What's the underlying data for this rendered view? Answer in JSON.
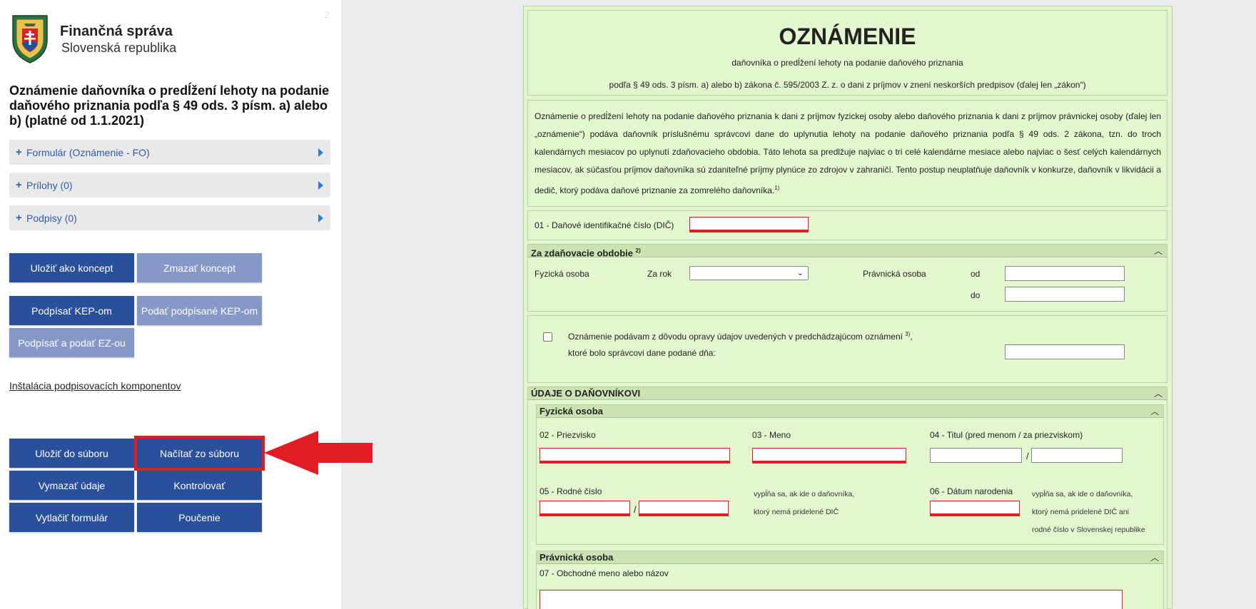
{
  "sidebar": {
    "page_number": "2",
    "brand_name": "Finančná správa",
    "brand_sub": "Slovenská republika",
    "doc_title": "Oznámenie daňovníka o predĺžení lehoty na podanie daňového priznania podľa § 49 ods. 3 písm. a) alebo b) (platné od 1.1.2021)",
    "accordion": [
      {
        "label": "Formulár (Oznámenie - FO)"
      },
      {
        "label": "Prílohy (0)"
      },
      {
        "label": "Podpisy (0)"
      }
    ],
    "buttons": {
      "save_draft": "Uložiť ako koncept",
      "delete_draft": "Zmazať koncept",
      "sign_kep": "Podpísať KEP-om",
      "submit_signed_kep": "Podať podpísané KEP-om",
      "sign_submit_ez": "Podpísať a podať EZ-ou",
      "save_file": "Uložiť do súboru",
      "load_file": "Načítať zo súboru",
      "clear_data": "Vymazať údaje",
      "validate": "Kontrolovať",
      "print": "Vytlačiť formulár",
      "instructions": "Poučenie"
    },
    "install_link": "Inštalácia podpisovacích komponentov"
  },
  "form": {
    "title": "OZNÁMENIE",
    "subtitle1": "daňovníka o predĺžení lehoty na podanie daňového priznania",
    "subtitle2": "podľa § 49 ods. 3 písm. a) alebo b) zákona č. 595/2003 Z. z. o dani z príjmov v znení neskorších predpisov (ďalej len „zákon“)",
    "intro": "Oznámenie o predĺžení lehoty na podanie daňového priznania k dani z príjmov fyzickej osoby alebo daňového priznania k dani z príjmov právnickej osoby (ďalej len „oznámenie“) podáva daňovník príslušnému správcovi dane do uplynutia lehoty na podanie daňového priznania podľa § 49 ods. 2 zákona, tzn. do troch kalendárnych mesiacov po uplynutí zdaňovacieho obdobia. Táto lehota sa predlžuje najviac o tri celé kalendárne mesiace alebo najviac o šesť celých kalendárnych mesiacov, ak súčasťou príjmov daňovníka sú zdaniteľné príjmy plynúce zo zdrojov v zahraničí. Tento postup neuplatňuje daňovník v konkurze, daňovník v likvidácii a dedič, ktorý podáva daňové priznanie za zomrelého daňovníka.",
    "intro_sup": "1)",
    "dic_label": "01 - Daňové identifikačné číslo (DIČ)",
    "period_header": "Za zdaňovacie obdobie",
    "period_sup": "2)",
    "fo_label": "Fyzická osoba",
    "year_label": "Za rok",
    "po_label": "Právnická osoba",
    "from_label": "od",
    "to_label": "do",
    "correction_text1": "Oznámenie podávam z dôvodu opravy údajov uvedených v predchádzajúcom oznámení",
    "correction_sup": "3)",
    "correction_text2": "ktoré bolo správcovi dane podané dňa:",
    "taxpayer_header": "ÚDAJE O DAŇOVNÍKOVI",
    "natural_header": "Fyzická osoba",
    "surname_label": "02 - Priezvisko",
    "name_label": "03 - Meno",
    "title_label": "04 - Titul (pred menom / za priezviskom)",
    "birthnum_label": "05 - Rodné číslo",
    "birthnum_note1": "vypĺňa sa, ak ide o daňovníka,",
    "birthnum_note2": "ktorý nemá pridelené DIČ",
    "birthdate_label": "06 - Dátum narodenia",
    "birthdate_note1": "vypĺňa sa, ak ide o daňovníka,",
    "birthdate_note2": "ktorý nemá pridelené DIČ ani",
    "birthdate_note3": "rodné číslo v Slovenskej republike",
    "legal_header": "Právnická osoba",
    "company_label": "07 - Obchodné meno alebo názov"
  },
  "colors": {
    "button_dark": "#2a4f9b",
    "button_light": "#8598c8",
    "form_bg": "#e3f7cf",
    "section_bg": "#cbe3b3",
    "required_red": "#e11c24"
  }
}
